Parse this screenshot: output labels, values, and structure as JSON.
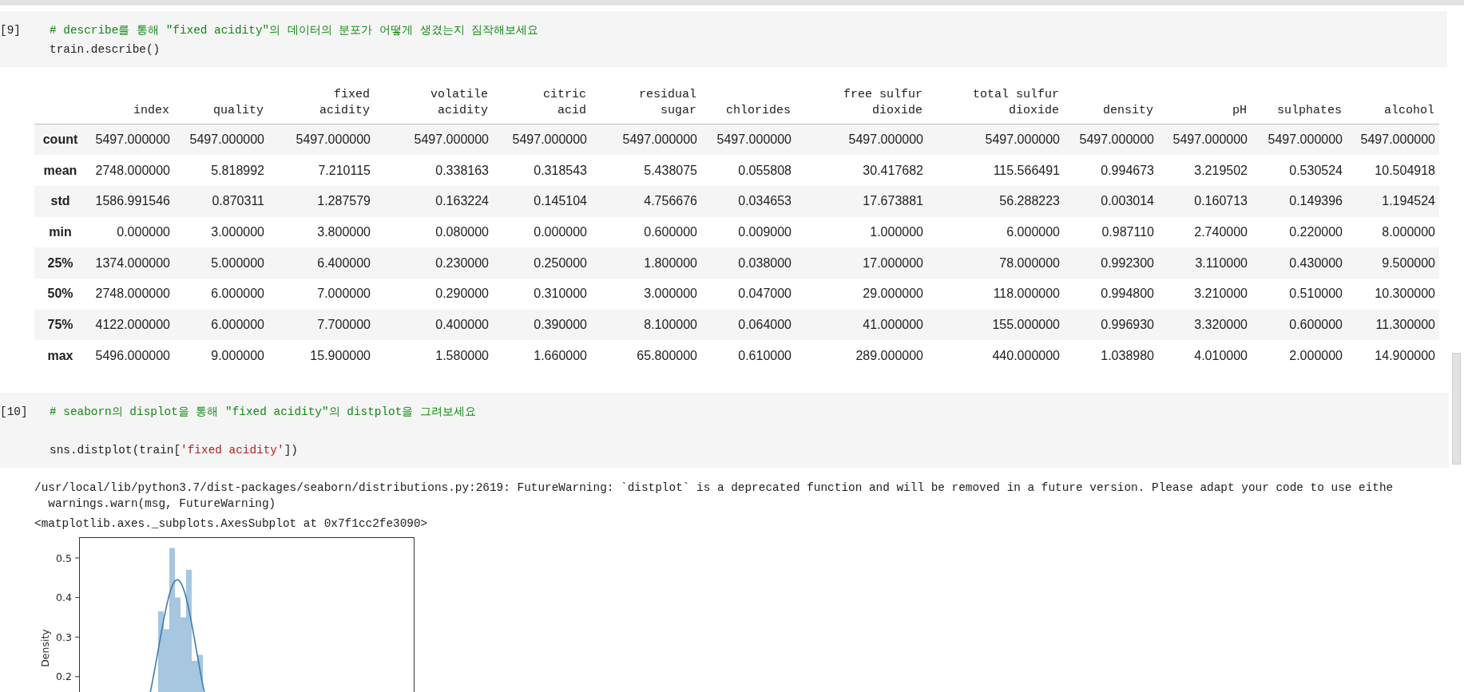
{
  "cells": [
    {
      "kind": "describe",
      "execution_count": "[9]",
      "code_lines": [
        {
          "tokens": [
            {
              "kind": "comment",
              "text": "# describe를 통해 \"fixed acidity\"의 데이터의 분포가 어떻게 생겼는지 짐작해보세요"
            }
          ]
        },
        {
          "tokens": [
            {
              "kind": "plain",
              "text": "train.describe()"
            }
          ]
        }
      ],
      "table": {
        "columns": [
          "index",
          "quality",
          "fixed\nacidity",
          "volatile\nacidity",
          "citric\nacid",
          "residual\nsugar",
          "chlorides",
          "free sulfur\ndioxide",
          "total sulfur\ndioxide",
          "density",
          "pH",
          "sulphates",
          "alcohol"
        ],
        "rows": [
          {
            "label": "count",
            "cells": [
              "5497.000000",
              "5497.000000",
              "5497.000000",
              "5497.000000",
              "5497.000000",
              "5497.000000",
              "5497.000000",
              "5497.000000",
              "5497.000000",
              "5497.000000",
              "5497.000000",
              "5497.000000",
              "5497.000000"
            ]
          },
          {
            "label": "mean",
            "cells": [
              "2748.000000",
              "5.818992",
              "7.210115",
              "0.338163",
              "0.318543",
              "5.438075",
              "0.055808",
              "30.417682",
              "115.566491",
              "0.994673",
              "3.219502",
              "0.530524",
              "10.504918"
            ]
          },
          {
            "label": "std",
            "cells": [
              "1586.991546",
              "0.870311",
              "1.287579",
              "0.163224",
              "0.145104",
              "4.756676",
              "0.034653",
              "17.673881",
              "56.288223",
              "0.003014",
              "0.160713",
              "0.149396",
              "1.194524"
            ]
          },
          {
            "label": "min",
            "cells": [
              "0.000000",
              "3.000000",
              "3.800000",
              "0.080000",
              "0.000000",
              "0.600000",
              "0.009000",
              "1.000000",
              "6.000000",
              "0.987110",
              "2.740000",
              "0.220000",
              "8.000000"
            ]
          },
          {
            "label": "25%",
            "cells": [
              "1374.000000",
              "5.000000",
              "6.400000",
              "0.230000",
              "0.250000",
              "1.800000",
              "0.038000",
              "17.000000",
              "78.000000",
              "0.992300",
              "3.110000",
              "0.430000",
              "9.500000"
            ]
          },
          {
            "label": "50%",
            "cells": [
              "2748.000000",
              "6.000000",
              "7.000000",
              "0.290000",
              "0.310000",
              "3.000000",
              "0.047000",
              "29.000000",
              "118.000000",
              "0.994800",
              "3.210000",
              "0.510000",
              "10.300000"
            ]
          },
          {
            "label": "75%",
            "cells": [
              "4122.000000",
              "6.000000",
              "7.700000",
              "0.400000",
              "0.390000",
              "8.100000",
              "0.064000",
              "41.000000",
              "155.000000",
              "0.996930",
              "3.320000",
              "0.600000",
              "11.300000"
            ]
          },
          {
            "label": "max",
            "cells": [
              "5496.000000",
              "9.000000",
              "15.900000",
              "1.580000",
              "1.660000",
              "65.800000",
              "0.610000",
              "289.000000",
              "440.000000",
              "1.038980",
              "4.010000",
              "2.000000",
              "14.900000"
            ]
          }
        ]
      }
    },
    {
      "kind": "plot",
      "execution_count": "[10]",
      "code_lines": [
        {
          "tokens": [
            {
              "kind": "comment",
              "text": "# seaborn의 displot을 통해 \"fixed acidity\"의 distplot을 그려보세요"
            }
          ]
        },
        {
          "kind": "blank"
        },
        {
          "kind": "code",
          "tokens": [
            {
              "kind": "plain",
              "text": "sns.distplot(train["
            },
            {
              "kind": "string",
              "text": "'fixed acidity'"
            },
            {
              "kind": "plain",
              "text": "])"
            }
          ]
        }
      ],
      "stderr": [
        "/usr/local/lib/python3.7/dist-packages/seaborn/distributions.py:2619: FutureWarning: `distplot` is a deprecated function and will be removed in a future version. Please adapt your code to use eithe",
        "  warnings.warn(msg, FutureWarning)"
      ],
      "result": "<matplotlib.axes._subplots.AxesSubplot at 0x7f1cc2fe3090>",
      "plot": {
        "y_axis_label": "Density",
        "y_tick_labels": [
          "0.5",
          "0.4",
          "0.3",
          "0.2"
        ]
      }
    }
  ]
}
